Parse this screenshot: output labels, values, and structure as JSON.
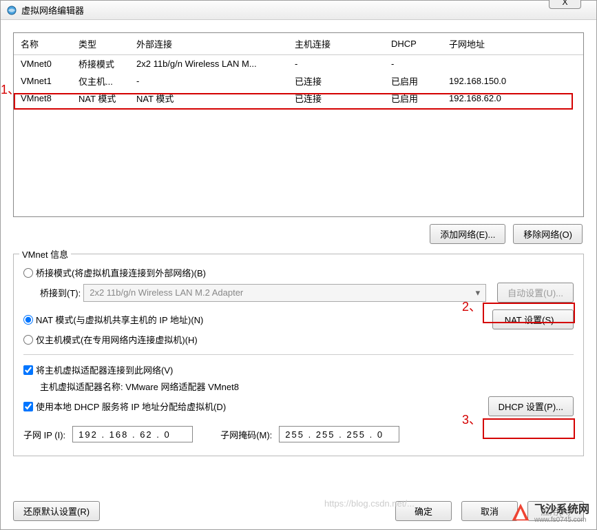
{
  "title": "虚拟网络编辑器",
  "close_x": "X",
  "columns": {
    "name": "名称",
    "type": "类型",
    "external": "外部连接",
    "host": "主机连接",
    "dhcp": "DHCP",
    "subnet": "子网地址"
  },
  "rows": [
    {
      "name": "VMnet0",
      "type": "桥接模式",
      "external": "2x2 11b/g/n Wireless LAN M...",
      "host": "-",
      "dhcp": "-",
      "subnet": ""
    },
    {
      "name": "VMnet1",
      "type": "仅主机...",
      "external": "-",
      "host": "已连接",
      "dhcp": "已启用",
      "subnet": "192.168.150.0"
    },
    {
      "name": "VMnet8",
      "type": "NAT 模式",
      "external": "NAT 模式",
      "host": "已连接",
      "dhcp": "已启用",
      "subnet": "192.168.62.0"
    }
  ],
  "buttons": {
    "add": "添加网络(E)...",
    "remove": "移除网络(O)"
  },
  "fieldset_title": "VMnet 信息",
  "radio_bridge": "桥接模式(将虚拟机直接连接到外部网络)(B)",
  "bridge_to": "桥接到(T):",
  "bridge_adapter": "2x2 11b/g/n Wireless LAN M.2 Adapter",
  "auto_settings": "自动设置(U)...",
  "radio_nat": "NAT 模式(与虚拟机共享主机的 IP 地址)(N)",
  "nat_settings": "NAT 设置(S)...",
  "radio_host": "仅主机模式(在专用网络内连接虚拟机)(H)",
  "check_connect": "将主机虚拟适配器连接到此网络(V)",
  "adapter_name_label": "主机虚拟适配器名称: VMware 网络适配器 VMnet8",
  "check_dhcp": "使用本地 DHCP 服务将 IP 地址分配给虚拟机(D)",
  "dhcp_settings": "DHCP 设置(P)...",
  "subnet_ip_label": "子网 IP (I):",
  "subnet_ip": "192 . 168 . 62 . 0",
  "subnet_mask_label": "子网掩码(M):",
  "subnet_mask": "255 . 255 . 255 . 0",
  "restore": "还原默认设置(R)",
  "ok": "确定",
  "cancel": "取消",
  "apply": "应用(A)",
  "annot1": "1、",
  "annot2": "2、",
  "annot3": "3、",
  "watermark_text": "飞沙系统网",
  "watermark_url": "www.fs0745.com",
  "csdn": "https://blog.csdn.net/..."
}
